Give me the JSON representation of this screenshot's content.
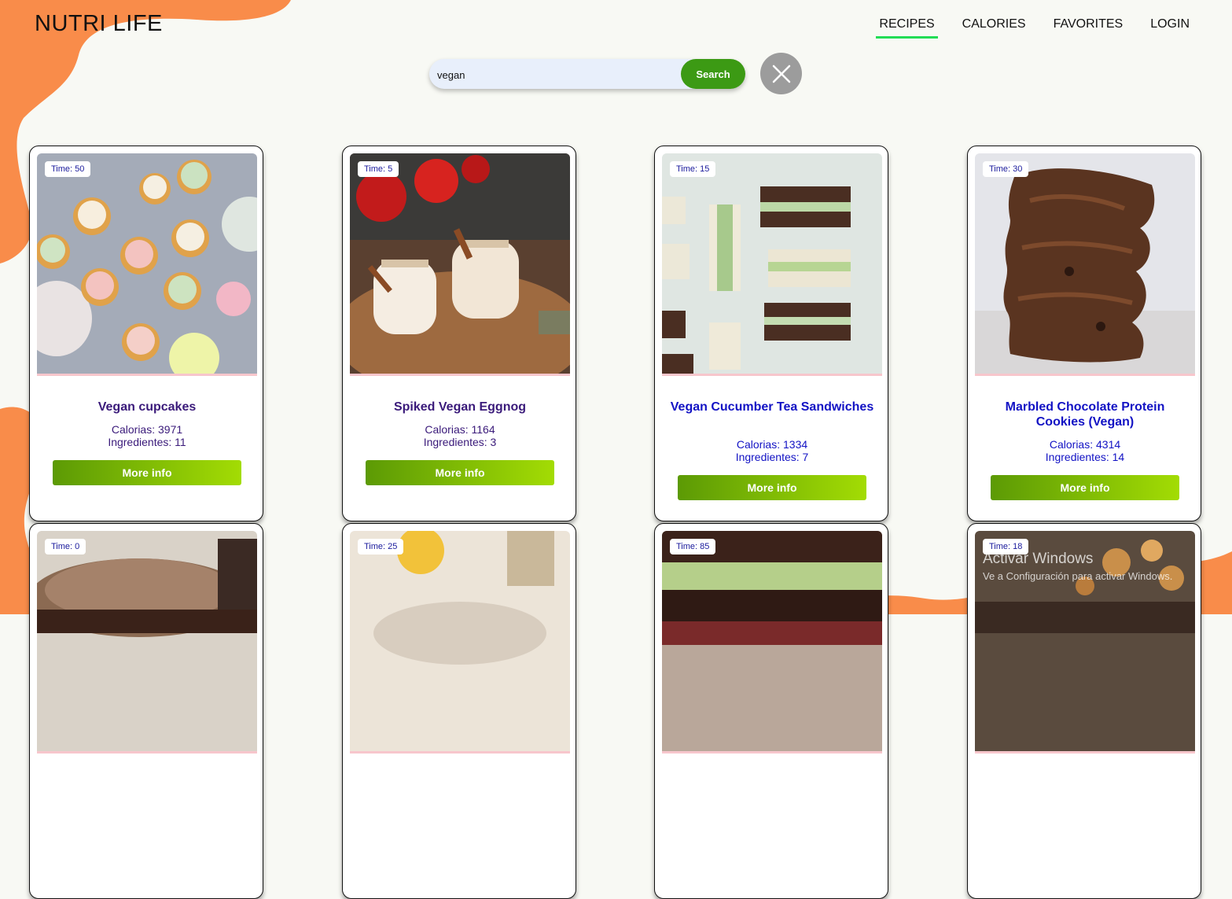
{
  "brand": {
    "logo": "NUTRI LIFE"
  },
  "nav": {
    "items": [
      {
        "label": "RECIPES",
        "active": true
      },
      {
        "label": "CALORIES",
        "active": false
      },
      {
        "label": "FAVORITES",
        "active": false
      },
      {
        "label": "LOGIN",
        "active": false
      }
    ]
  },
  "search": {
    "value": "vegan",
    "button_label": "Search"
  },
  "colors": {
    "accent": "#3c9a14",
    "nav_active": "#22dd55",
    "blob": "#f98c4a"
  },
  "cards": [
    {
      "time": "Time: 50",
      "title": "Vegan cupcakes",
      "calories": "Calorias: 3971",
      "ingredients": "Ingredientes: 11",
      "button": "More info"
    },
    {
      "time": "Time: 5",
      "title": "Spiked Vegan Eggnog",
      "calories": "Calorias: 1164",
      "ingredients": "Ingredientes: 3",
      "button": "More info"
    },
    {
      "time": "Time: 15",
      "title": "Vegan Cucumber Tea Sandwiches",
      "calories": "Calorias: 1334",
      "ingredients": "Ingredientes: 7",
      "button": "More info"
    },
    {
      "time": "Time: 30",
      "title": "Marbled Chocolate Protein Cookies (Vegan)",
      "calories": "Calorias: 4314",
      "ingredients": "Ingredientes: 14",
      "button": "More info"
    },
    {
      "time": "Time: 0"
    },
    {
      "time": "Time: 25"
    },
    {
      "time": "Time: 85"
    },
    {
      "time": "Time: 18"
    }
  ],
  "watermark": {
    "line1": "Activar Windows",
    "line2": "Ve a Configuración para activar Windows."
  }
}
